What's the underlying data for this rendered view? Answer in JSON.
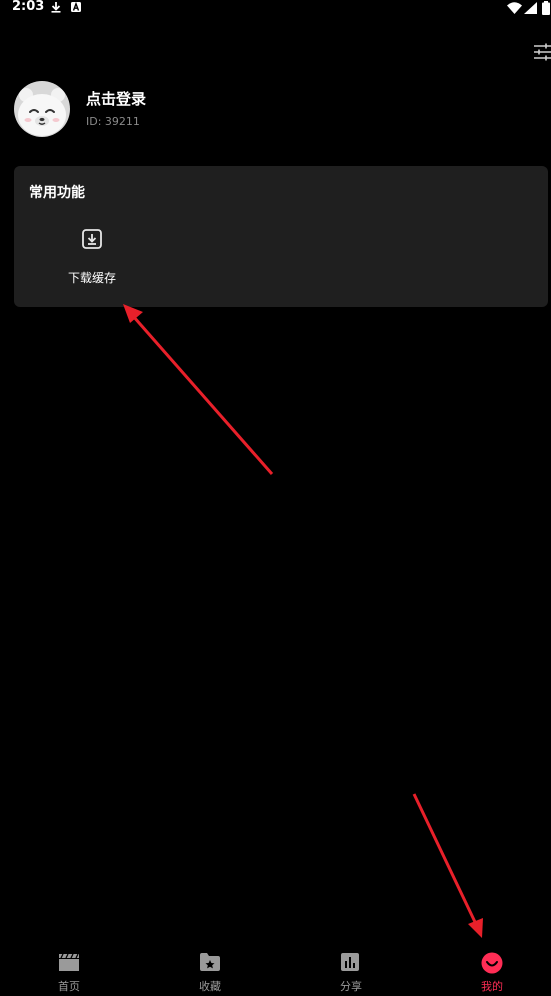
{
  "status_bar": {
    "time": "2:03"
  },
  "profile": {
    "login_label": "点击登录",
    "user_id": "ID: 39211"
  },
  "functions_card": {
    "title": "常用功能",
    "items": [
      {
        "label": "下载缓存",
        "icon": "download-box-icon"
      }
    ]
  },
  "bottom_nav": {
    "items": [
      {
        "label": "首页",
        "icon": "clapperboard-icon"
      },
      {
        "label": "收藏",
        "icon": "folder-star-icon"
      },
      {
        "label": "分享",
        "icon": "bar-chart-icon"
      },
      {
        "label": "我的",
        "icon": "smile-icon",
        "active": true
      }
    ]
  },
  "colors": {
    "background": "#000000",
    "card": "#1f1f1f",
    "accent": "#ff2d55",
    "annotation_arrow": "#e8202a",
    "inactive_nav": "#9a9a9a"
  }
}
